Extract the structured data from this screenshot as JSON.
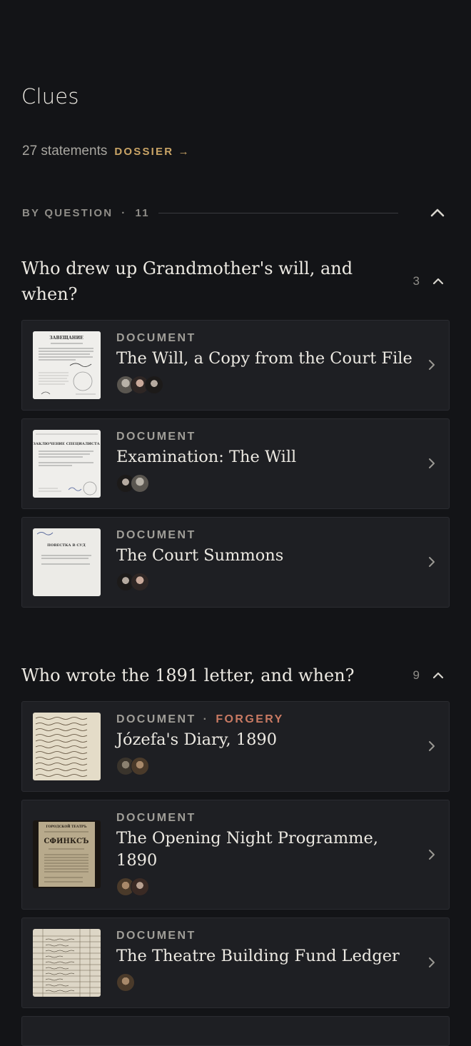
{
  "header": {
    "title": "Clues"
  },
  "summary": {
    "count": "27 statements",
    "dossier_label": "DOSSIER →"
  },
  "section": {
    "label": "BY QUESTION",
    "dot": "·",
    "count": "11"
  },
  "questions": [
    {
      "title": "Who drew up Grandmother's will, and when?",
      "count": "3",
      "cards": [
        {
          "kind": "DOCUMENT",
          "title": "The Will, a Copy from the Court File",
          "thumb_heading": "ЗАВЕЩАНИЕ"
        },
        {
          "kind": "DOCUMENT",
          "title": "Examination: The Will",
          "thumb_heading": "ЗАКЛЮЧЕНИЕ СПЕЦИАЛИСТА"
        },
        {
          "kind": "DOCUMENT",
          "title": "The Court Summons",
          "thumb_heading": "ПОВЕСТКА В СУД"
        }
      ]
    },
    {
      "title": "Who wrote the 1891 letter, and when?",
      "count": "9",
      "cards": [
        {
          "kind": "DOCUMENT",
          "sep": "·",
          "tag": "FORGERY",
          "title": "Józefa's Diary, 1890"
        },
        {
          "kind": "DOCUMENT",
          "title": "The Opening Night Programme, 1890",
          "thumb_heading": "СФИНКСЪ",
          "thumb_sub": "ГОРОДСКОЙ ТЕАТРЪ"
        },
        {
          "kind": "DOCUMENT",
          "title": "The Theatre Building Fund Ledger"
        }
      ]
    }
  ],
  "colors": {
    "background": "#131417",
    "card": "#1e1f23",
    "accent": "#c9a466",
    "forgery": "#c97a63"
  },
  "icons": {
    "chevron_right": "chevron-right-icon",
    "collapse": "chevron-up-icon",
    "arrow": "arrow-right-icon"
  }
}
